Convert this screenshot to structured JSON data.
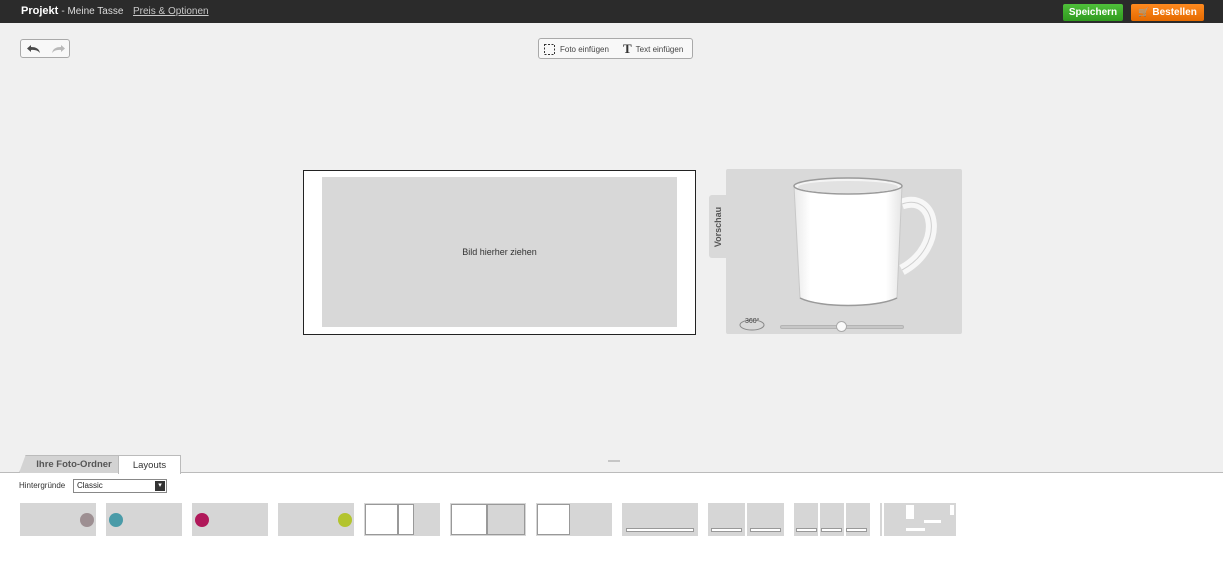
{
  "header": {
    "project_label": "Projekt",
    "project_name": "- Meine Tasse",
    "price_link": "Preis & Optionen",
    "save_label": "Speichern",
    "order_label": "Bestellen"
  },
  "toolbar": {
    "insert_photo": "Foto einfügen",
    "insert_text": "Text einfügen"
  },
  "canvas": {
    "drop_hint": "Bild hierher ziehen"
  },
  "preview": {
    "tab_label": "Vorschau",
    "rotate_label": "360°",
    "rotation_slider_value": 0.5
  },
  "bottom": {
    "tabs": [
      {
        "label": "Ihre Foto-Ordner",
        "active": false
      },
      {
        "label": "Layouts",
        "active": true
      }
    ],
    "backgrounds_label": "Hintergründe",
    "backgrounds_value": "Classic"
  },
  "colors": {
    "save": "#3aa52a",
    "order": "#f07a10",
    "dot_grey": "#9d8f92",
    "dot_teal": "#4a9ba8",
    "dot_magenta": "#b0185a",
    "dot_lime": "#b3c42e"
  }
}
